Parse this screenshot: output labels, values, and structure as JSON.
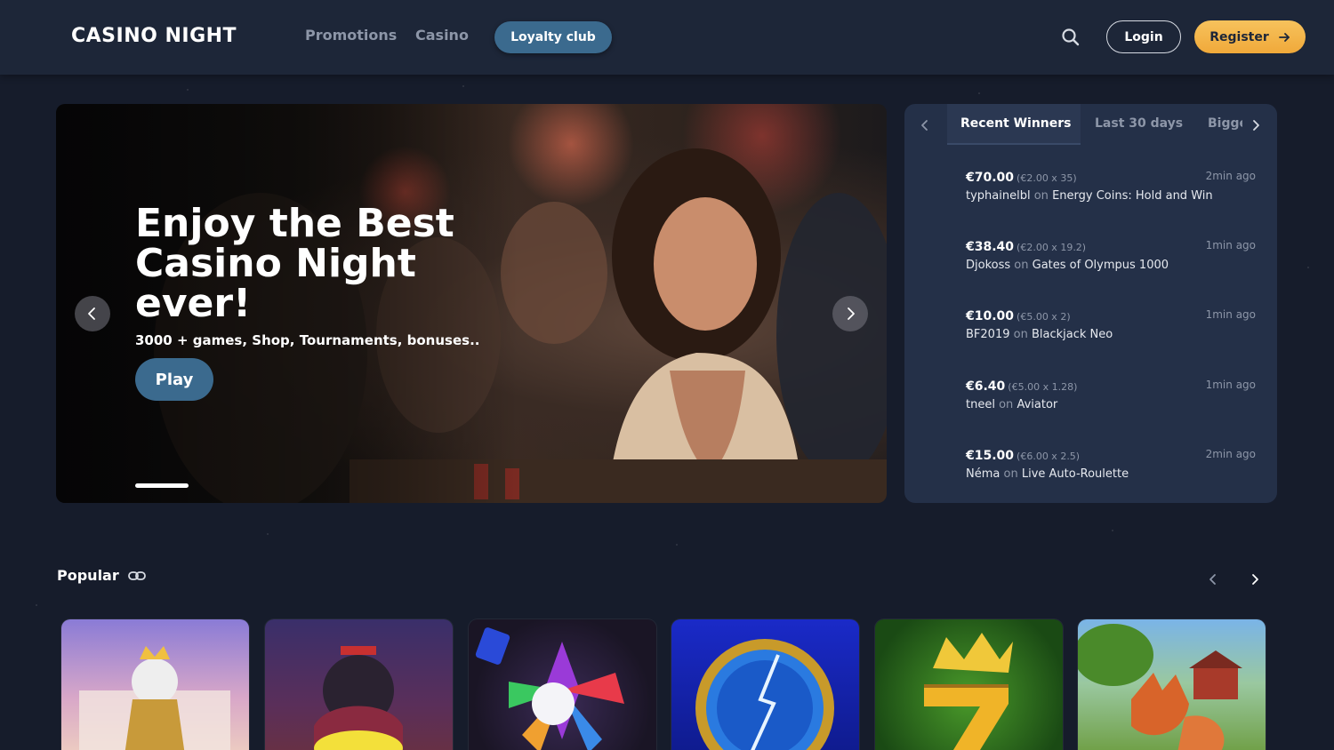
{
  "header": {
    "logo": "CASINO NIGHT",
    "nav": [
      "Promotions",
      "Casino"
    ],
    "loyalty_label": "Loyalty club",
    "login_label": "Login",
    "register_label": "Register"
  },
  "hero": {
    "title": "Enjoy the Best Casino Night ever!",
    "subtitle": "3000 + games, Shop, Tournaments, bonuses..",
    "play_label": "Play"
  },
  "winners": {
    "tabs": [
      "Recent Winners",
      "Last 30 days",
      "Biggest"
    ],
    "active_tab": "Recent Winners",
    "rows": [
      {
        "amount": "€70.00",
        "calc": "(€2.00 x 35)",
        "time": "2min ago",
        "user": "typhainelbl",
        "on": "on",
        "game": "Energy Coins: Hold and Win"
      },
      {
        "amount": "€38.40",
        "calc": "(€2.00 x 19.2)",
        "time": "1min ago",
        "user": "Djokoss",
        "on": "on",
        "game": "Gates of Olympus 1000"
      },
      {
        "amount": "€10.00",
        "calc": "(€5.00 x 2)",
        "time": "1min ago",
        "user": "BF2019",
        "on": "on",
        "game": "Blackjack Neo"
      },
      {
        "amount": "€6.40",
        "calc": "(€5.00 x 1.28)",
        "time": "1min ago",
        "user": "tneel",
        "on": "on",
        "game": "Aviator"
      },
      {
        "amount": "€15.00",
        "calc": "(€6.00 x 2.5)",
        "time": "2min ago",
        "user": "Néma",
        "on": "on",
        "game": "Live Auto-Roulette"
      }
    ]
  },
  "popular": {
    "title": "Popular"
  },
  "colors": {
    "background": "#161c2b",
    "header": "#1d2638",
    "panel": "#243048",
    "accent_blue": "#3b6a8e",
    "accent_gold": "#f0a93a"
  },
  "icons": {
    "search": "search-icon",
    "arrow_right": "arrow-right-icon",
    "chevron_left": "chevron-left-icon",
    "chevron_right": "chevron-right-icon",
    "link": "link-icon"
  }
}
